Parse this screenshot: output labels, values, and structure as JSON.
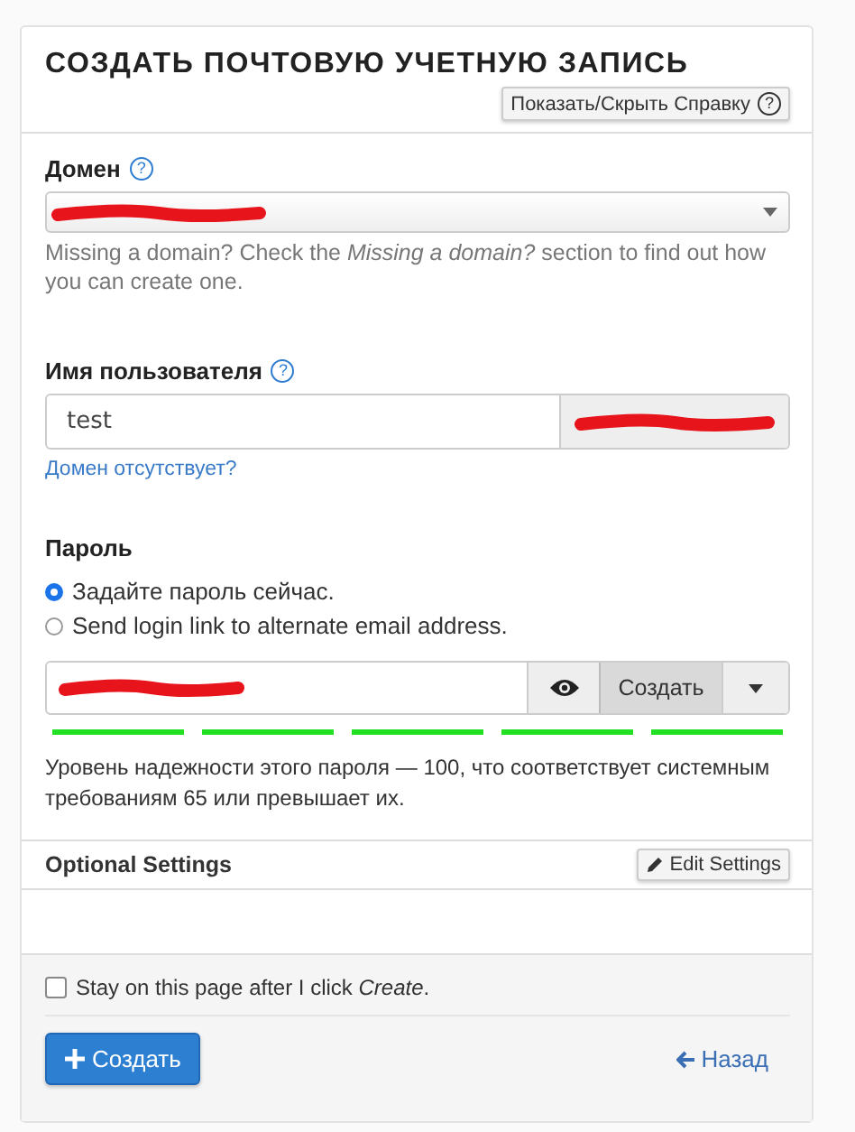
{
  "title": "СОЗДАТЬ ПОЧТОВУЮ УЧЕТНУЮ ЗАПИСЬ",
  "help_toggle": {
    "label": "Показать/Скрыть Справку",
    "icon": "?"
  },
  "domain": {
    "label": "Домен",
    "help_icon": "?",
    "redacted": true,
    "help_text": "Missing a domain? Check the *Missing a domain?* section to find out how you can create one."
  },
  "username": {
    "label": "Имя пользователя",
    "help_icon": "?",
    "value": "test",
    "suffix_redacted": true,
    "link": "Домен отсутствует?"
  },
  "password": {
    "label": "Пароль",
    "options": [
      {
        "label": "Задайте пароль сейчас.",
        "selected": true
      },
      {
        "label": "Send login link to alternate email address.",
        "selected": false
      }
    ],
    "redacted": true,
    "generate_button": "Создать",
    "strength_text": "Уровень надежности этого пароля — 100, что соответствует системным требованиям 65 или превышает их."
  },
  "optional_settings": {
    "title": "Optional Settings",
    "button": "Edit Settings"
  },
  "stay_on_page": {
    "label": "Stay on this page after I click *Create*.",
    "checked": false
  },
  "create_button": "Создать",
  "back_link": "Назад"
}
